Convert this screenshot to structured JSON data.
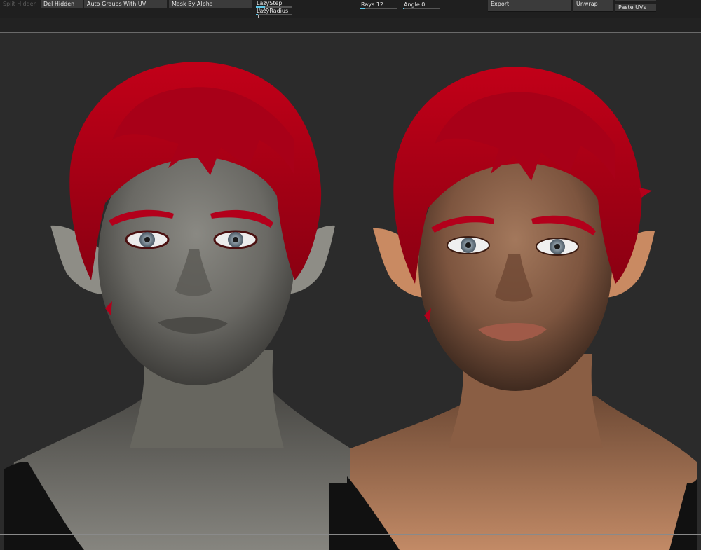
{
  "toolbar": {
    "split_hidden": "Split Hidden",
    "del_hidden": "Del Hidden",
    "auto_groups_uv": "Auto Groups With UV",
    "mask_by_alpha": "Mask By Alpha",
    "lazy_step": "LazyStep 0.25",
    "lazy_radius": "LazyRadius 1",
    "rays": "Rays 12",
    "angle": "Angle 0",
    "export": "Export",
    "unwrap": "Unwrap",
    "paste_uvs": "Paste UVs"
  },
  "sliders": {
    "lazy_step_level": 0.25,
    "lazy_radius_level": 0.05,
    "rays_level": 0.12,
    "angle_level": 0.0
  },
  "viewport": {
    "left_model": "grey-shaded-head",
    "right_model": "textured-skin-head",
    "hair_color": "#b3001b",
    "grey_skin_color": "#6e6d68",
    "tan_skin_color": "#b47a5a",
    "background_color": "#2b2b2b"
  }
}
